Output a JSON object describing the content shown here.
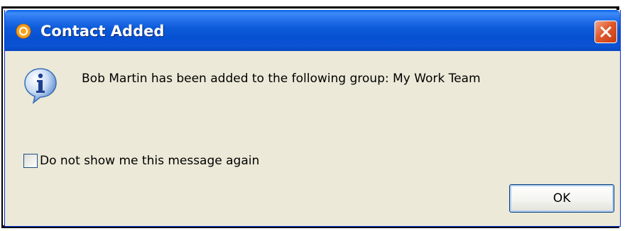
{
  "window": {
    "title": "Contact Added",
    "titlebar_color": "#0a54d4",
    "background_color": "#ece9d8",
    "app_icon": "app-logo-icon",
    "close_icon": "close-icon",
    "info_icon": "info-icon"
  },
  "dialog": {
    "message": "Bob Martin has been added to the following group: My Work Team",
    "checkbox_label": "Do not show me this message again",
    "checkbox_checked": false,
    "ok_label": "OK"
  }
}
